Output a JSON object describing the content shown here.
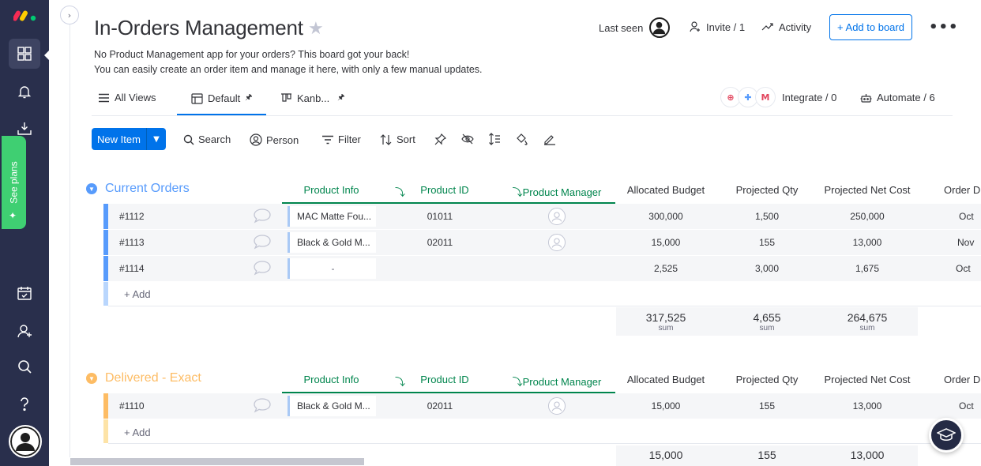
{
  "rail": {
    "items": [
      "workspaces-icon",
      "notifications-icon",
      "inbox-icon",
      "my-work-icon",
      "invite-members-icon",
      "search-icon",
      "help-icon"
    ],
    "see_plans": "See plans"
  },
  "board": {
    "title": "In-Orders Management",
    "description_line1": "No Product Management app for your orders? This board got your back!",
    "description_line2": "You can easily create an order item and manage it here, with only a few manual updates."
  },
  "header": {
    "last_seen": "Last seen",
    "invite": "Invite / 1",
    "activity": "Activity",
    "add_to_board": "+ Add to board"
  },
  "views": {
    "all_views": "All Views",
    "default": "Default",
    "kanban": "Kanb...",
    "integrate": "Integrate / 0",
    "automate": "Automate / 6"
  },
  "toolbar": {
    "new_item": "New Item",
    "search": "Search",
    "person": "Person",
    "filter": "Filter",
    "sort": "Sort"
  },
  "columns": {
    "product_info": "Product Info",
    "product_id": "Product ID",
    "product_manager": "Product Manager",
    "allocated_budget": "Allocated Budget",
    "projected_qty": "Projected Qty",
    "projected_net_cost": "Projected Net Cost",
    "order_date": "Order D"
  },
  "groups": [
    {
      "title": "Current Orders",
      "color": "#579bfc",
      "rows": [
        {
          "name": "#1112",
          "product_info": "MAC Matte Fou...",
          "product_id": "01011",
          "budget": "300,000",
          "qty": "1,500",
          "net_cost": "250,000",
          "order_date": "Oct"
        },
        {
          "name": "#1113",
          "product_info": "Black & Gold M...",
          "product_id": "02011",
          "budget": "15,000",
          "qty": "155",
          "net_cost": "13,000",
          "order_date": "Nov"
        },
        {
          "name": "#1114",
          "product_info": "-",
          "product_id": "",
          "budget": "2,525",
          "qty": "3,000",
          "net_cost": "1,675",
          "order_date": "Oct"
        }
      ],
      "add_label": "+ Add",
      "sums": {
        "budget": "317,525",
        "qty": "4,655",
        "net_cost": "264,675",
        "label": "sum"
      }
    },
    {
      "title": "Delivered - Exact",
      "color": "#fdbc64",
      "rows": [
        {
          "name": "#1110",
          "product_info": "Black & Gold M...",
          "product_id": "02011",
          "budget": "15,000",
          "qty": "155",
          "net_cost": "13,000",
          "order_date": "Oct"
        }
      ],
      "add_label": "+ Add",
      "sums": {
        "budget": "15,000",
        "qty": "155",
        "net_cost": "13,000"
      }
    }
  ]
}
